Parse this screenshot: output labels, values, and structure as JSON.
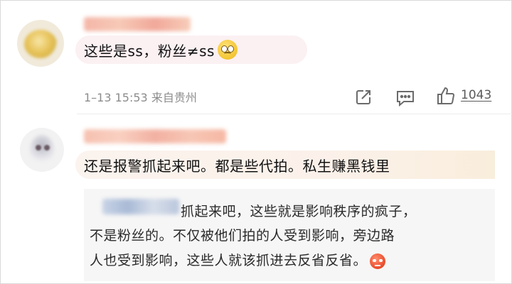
{
  "comments": [
    {
      "text": "这些是ss，粉丝≠ss",
      "emoji": "sad-face-emoji",
      "meta": "1–13 15:53 来自贵州",
      "likes": "1043"
    },
    {
      "text": "还是报警抓起来吧。都是些代拍。私生赚黑钱里"
    }
  ],
  "reply": {
    "lines": [
      "抓起来吧，这些就是影响秩序的疯子，",
      "不是粉丝的。不仅被他们拍的人受到影响，旁边路",
      "人也受到影响，这些人就该抓进去反省反省。"
    ],
    "emoji": "angry-face-emoji"
  },
  "icons": [
    "share-icon",
    "comment-icon",
    "thumbs-up-icon"
  ],
  "colors": {
    "bubble": "#fbf0f2",
    "meta_text": "#8c8c8c",
    "reply_bg": "#f6f6f6"
  }
}
